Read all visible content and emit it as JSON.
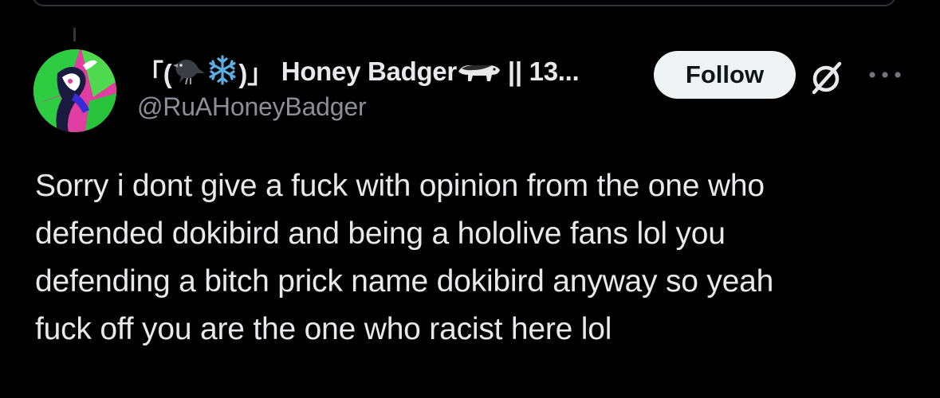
{
  "post": {
    "author": {
      "name_prefix": "「(",
      "name_mid": ")」",
      "name_main": "Honey Badger",
      "name_suffix": "|| 13...",
      "handle": "@RuAHoneyBadger"
    },
    "follow_label": "Follow",
    "text_lines": [
      "Sorry i dont give a fuck with opinion from the one who",
      "defended dokibird and being a hololive fans lol you",
      "defending a bitch prick name dokibird anyway so yeah",
      "fuck off you are the one who racist here lol"
    ]
  },
  "icons": {
    "avatar": "avatar-image",
    "crow": "crow-emoji",
    "snowflake": "snowflake-emoji",
    "badger": "badger-emoji",
    "grok": "grok-icon",
    "more": "more-icon"
  },
  "colors": {
    "background": "#000000",
    "text": "#e7e9ea",
    "secondary_text": "#8b9096",
    "follow_bg": "#eff3f4",
    "follow_text": "#0f1419",
    "snowflake": "#5dade2"
  }
}
